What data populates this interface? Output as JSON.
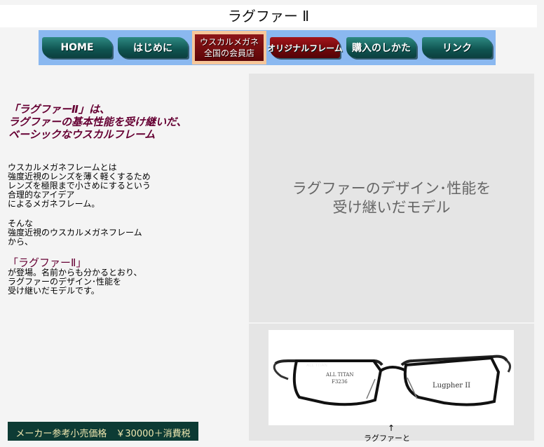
{
  "page": {
    "title": "ラグファー Ⅱ"
  },
  "nav": {
    "home": "HOME",
    "intro": "はじめに",
    "member_line1": "ウスカルメガネ",
    "member_line2": "全国の会員店",
    "original": "オリジナルフレーム",
    "howto": "購入のしかた",
    "link": "リンク"
  },
  "content": {
    "headline": [
      "「ラグファーⅡ」は、",
      "ラグファーの基本性能を受け継いだ、",
      "ベーシックなウスカルフレーム"
    ],
    "para1": [
      "ウスカルメガネフレームとは",
      "強度近視のレンズを薄く軽くするため",
      "レンズを極限まで小さめにするという",
      "合理的なアイデア",
      "によるメガネフレーム。"
    ],
    "para2": [
      "そんな",
      "強度近視のウスカルメガネフレーム",
      "から、"
    ],
    "product_name": "「ラグファーⅡ」",
    "para3": [
      "が登場。名前からも分かるとおり、",
      "ラグファーのデザイン･性能を",
      "受け継いだモデルです。"
    ],
    "price": "メーカー参考小売価格　￥30000＋消費税"
  },
  "right": {
    "tagline": [
      "ラグファーのデザイン･性能を",
      "受け継いだモデル"
    ],
    "arrow": "↑",
    "caption": "ラグファーと",
    "frame_text": {
      "temple_left": "ALL TITAN",
      "lens_left_1": "ALL TITAN",
      "lens_left_2": "F3236",
      "lens_right": "Lugpher II"
    }
  },
  "colors": {
    "nav_bg": "#8ab8f0",
    "active_bg": "#f6c79b",
    "headline": "#660033",
    "price_bg": "#0d3b34"
  }
}
